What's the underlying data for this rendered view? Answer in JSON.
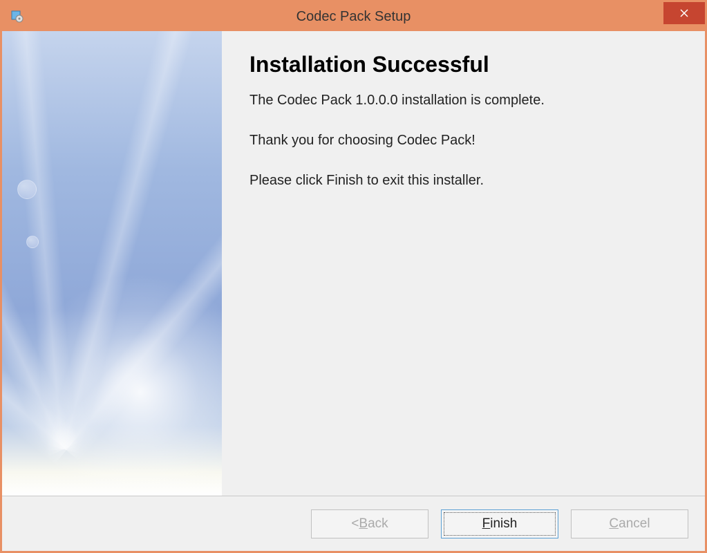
{
  "title": "Codec Pack Setup",
  "content": {
    "heading": "Installation Successful",
    "line1": "The Codec Pack 1.0.0.0 installation is complete.",
    "line2": "Thank you for choosing Codec Pack!",
    "line3": "Please click Finish to exit this installer."
  },
  "buttons": {
    "back_prefix": "< ",
    "back_u": "B",
    "back_rest": "ack",
    "finish_u": "F",
    "finish_rest": "inish",
    "cancel_u": "C",
    "cancel_rest": "ancel"
  }
}
